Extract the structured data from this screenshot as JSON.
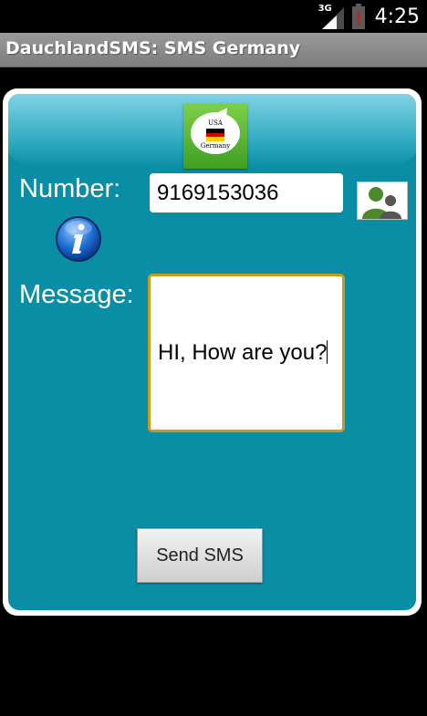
{
  "status_bar": {
    "network_type": "3G",
    "time": "4:25"
  },
  "app": {
    "title": "DauchlandSMS: SMS Germany"
  },
  "logo": {
    "top_text": "USA",
    "bottom_text": "Germany",
    "flag_colors": [
      "#000000",
      "#dd0000",
      "#ffce00"
    ],
    "background_color": "#5ab532"
  },
  "form": {
    "number_label": "Number:",
    "number_value": "9169153036",
    "message_label": "Message:",
    "message_value": "HI, How are you?",
    "send_label": "Send SMS"
  },
  "icons": {
    "contact_picker": "contacts-icon",
    "info": "info-icon",
    "signal": "signal-icon",
    "battery": "battery-icon"
  },
  "colors": {
    "panel": "#0a8ea5",
    "panel_border": "#ffffff",
    "title_bar": "#8a8a8a",
    "message_border": "#c89a1e",
    "battery_alert": "#cc1b1b"
  }
}
